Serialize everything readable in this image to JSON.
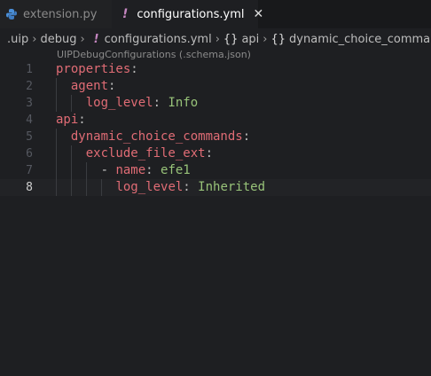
{
  "tabs": [
    {
      "label": "extension.py",
      "icon": "python-icon"
    },
    {
      "label": "configurations.yml",
      "icon": "yaml-icon",
      "close": "✕"
    }
  ],
  "breadcrumb": {
    "items": [
      ".uip",
      "debug"
    ],
    "file": "configurations.yml",
    "file_icon": "!",
    "symbol_icon": "{}",
    "symbols": [
      "api",
      "dynamic_choice_commands"
    ],
    "separator": "›"
  },
  "schema_hint": "UIPDebugConfigurations (.schema.json)",
  "editor": {
    "active_line": 8,
    "lines": [
      {
        "num": "1",
        "indent": 0,
        "dash": "",
        "key": "properties",
        "colon": ":",
        "value": ""
      },
      {
        "num": "2",
        "indent": 1,
        "dash": "",
        "key": "agent",
        "colon": ":",
        "value": ""
      },
      {
        "num": "3",
        "indent": 2,
        "dash": "",
        "key": "log_level",
        "colon": ":",
        "value": " Info"
      },
      {
        "num": "4",
        "indent": 0,
        "dash": "",
        "key": "api",
        "colon": ":",
        "value": ""
      },
      {
        "num": "5",
        "indent": 1,
        "dash": "",
        "key": "dynamic_choice_commands",
        "colon": ":",
        "value": ""
      },
      {
        "num": "6",
        "indent": 2,
        "dash": "",
        "key": "exclude_file_ext",
        "colon": ":",
        "value": ""
      },
      {
        "num": "7",
        "indent": 3,
        "dash": "- ",
        "key": "name",
        "colon": ":",
        "value": " efe1"
      },
      {
        "num": "8",
        "indent": 4,
        "dash": "",
        "key": "log_level",
        "colon": ":",
        "value": " Inherited"
      }
    ]
  },
  "colors": {
    "key": "#e06c75",
    "value": "#98c379",
    "yaml_icon": "#c586c0",
    "background": "#1e1f22"
  }
}
